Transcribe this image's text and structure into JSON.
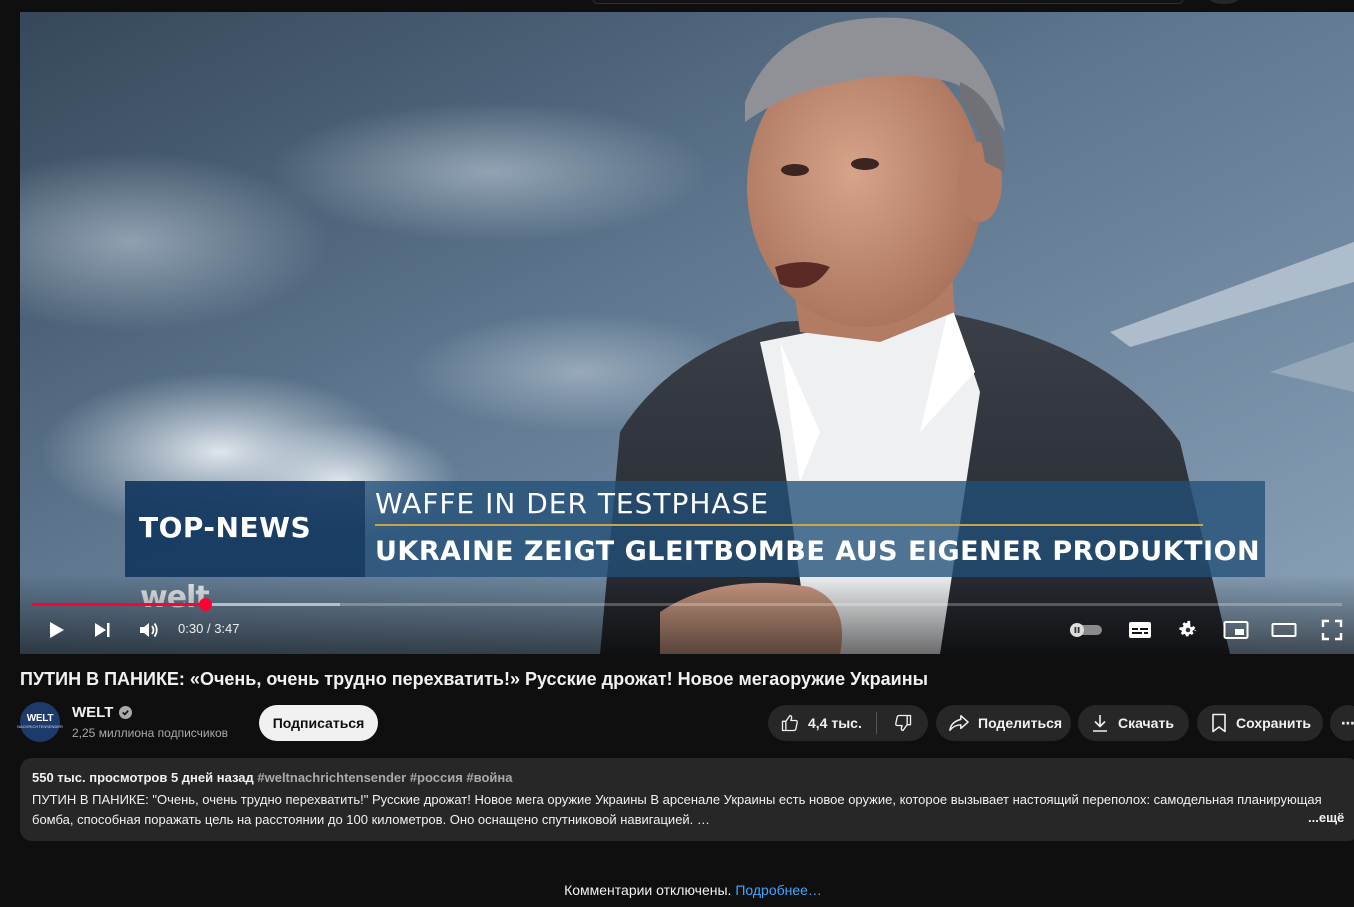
{
  "player": {
    "overlay_category": "TOP-NEWS",
    "overlay_headline_top": "WAFFE IN DER TESTPHASE",
    "overlay_headline_bottom": "UKRAINE ZEIGT GLEITBOMBE AUS EIGENER PRODUKTION",
    "overlay_logo": "welt",
    "current_time": "0:30",
    "separator": "/",
    "duration": "3:47",
    "progress_fraction": 0.132,
    "buffered_fraction": 0.235,
    "icons": {
      "play": "play-icon",
      "next": "next-icon",
      "volume": "volume-icon",
      "autoplay": "autoplay-toggle-icon",
      "subtitles": "subtitles-icon",
      "settings": "gear-icon",
      "miniplayer": "miniplayer-icon",
      "theater": "theater-mode-icon",
      "fullscreen": "fullscreen-icon"
    }
  },
  "video": {
    "title": "ПУТИН В ПАНИКЕ: «Очень, очень трудно перехватить!» Русские дрожат! Новое мегаоружие Украины"
  },
  "channel": {
    "avatar_text": "WELT",
    "avatar_subtext": "NACHRICHTENSENDER",
    "name": "WELT",
    "subscribers": "2,25 миллиона подписчиков",
    "subscribe_label": "Подписаться"
  },
  "actions": {
    "likes": "4,4 тыс.",
    "share_label": "Поделиться",
    "download_label": "Скачать",
    "save_label": "Сохранить",
    "more_label": "⋯"
  },
  "description": {
    "views": "550 тыс. просмотров",
    "date": "5 дней назад",
    "hashtags": "#weltnachrichtensender #россия #война",
    "text": "ПУТИН В ПАНИКЕ: \"Очень, очень трудно перехватить!\" Русские дрожат! Новое мега оружие Украины В арсенале Украины есть новое оружие, которое вызывает настоящий переполох: самодельная планирующая бомба, способная поражать цель на расстоянии до 100 километров. Оно оснащено спутниковой навигацией. …",
    "more_label": "...ещё"
  },
  "comments": {
    "disabled_text": "Комментарии отключены.",
    "learn_more": "Подробнее…"
  },
  "colors": {
    "background": "#0f0f0f",
    "surface": "#272727",
    "accent_red": "#ff0033",
    "link_blue": "#3ea6ff",
    "overlay_gold": "#c9a24a"
  }
}
